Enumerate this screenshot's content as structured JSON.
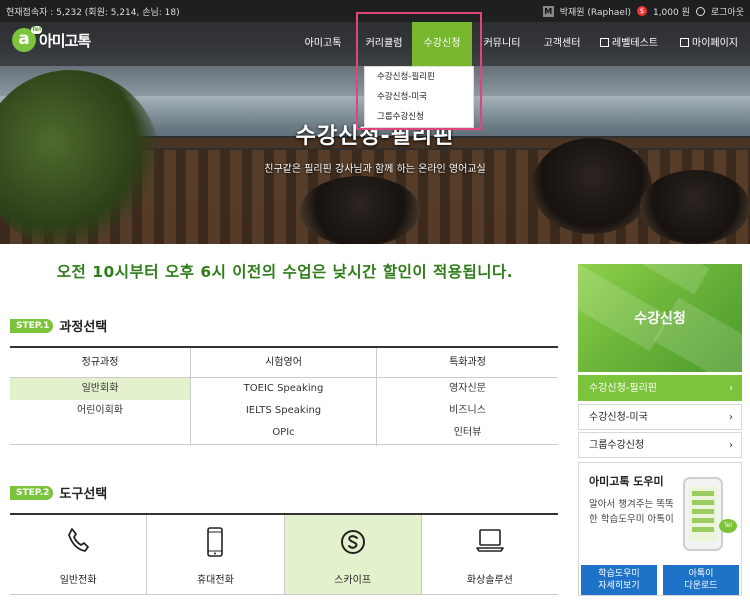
{
  "topbar": {
    "stat": "현재접속자 : 5,232 (회원: 5,214, 손님: 18)",
    "user_name": "박재원 (Raphael)",
    "points": "1,000 원",
    "logout": "로그아웃",
    "m_badge": "M",
    "coin": "$"
  },
  "logo": {
    "mark": "a",
    "tiny": "Tel",
    "word": "아미고톡"
  },
  "nav": [
    {
      "label": "아미고톡"
    },
    {
      "label": "커리큘럼"
    },
    {
      "label": "수강신청",
      "active": true
    },
    {
      "label": "커뮤니티"
    },
    {
      "label": "고객센터"
    },
    {
      "label": "레벨테스트"
    },
    {
      "label": "마이페이지"
    }
  ],
  "dropdown": [
    "수강신청-필리핀",
    "수강신청-미국",
    "그룹수강신청"
  ],
  "hero": {
    "title": "수강신청-필리핀",
    "subtitle": "친구같은 필리핀 강사님과 함께 하는 온라인 영어교실"
  },
  "notice": "오전 10시부터 오후 6시 이전의 수업은 낮시간 할인이 적용됩니다.",
  "step1": {
    "badge": "STEP.1",
    "title": "과정선택"
  },
  "courses": {
    "headers": [
      "정규과정",
      "시험영어",
      "특화과정"
    ],
    "columns": [
      [
        "일반회화",
        "어린이회화"
      ],
      [
        "TOEIC Speaking",
        "IELTS Speaking",
        "OPIc"
      ],
      [
        "영자신문",
        "비즈니스",
        "인터뷰"
      ]
    ],
    "selected": "일반회화"
  },
  "step2": {
    "badge": "STEP.2",
    "title": "도구선택"
  },
  "tools": [
    {
      "label": "일반전화",
      "icon": "phone-icon"
    },
    {
      "label": "휴대전화",
      "icon": "mobile-icon"
    },
    {
      "label": "스카이프",
      "icon": "skype-icon",
      "selected": true
    },
    {
      "label": "화상솔루션",
      "icon": "laptop-icon"
    }
  ],
  "sidebar": {
    "banner": "수강신청",
    "menu": [
      "수강신청-필리핀",
      "수강신청-미국",
      "그룹수강신청"
    ],
    "helper": {
      "title": "아미고톡 도우미",
      "desc": "알아서 챙겨주는 똑똑한 학습도우미 아톡이",
      "bubble": "Tel",
      "btn1_line1": "학습도우미",
      "btn1_line2": "자세히보기",
      "btn2_line1": "아톡이",
      "btn2_line2": "다운로드"
    }
  },
  "colors": {
    "accent": "#7cc43b",
    "notice": "#2f7d1a",
    "highlight": "#e0457b",
    "button": "#1e73c8"
  }
}
